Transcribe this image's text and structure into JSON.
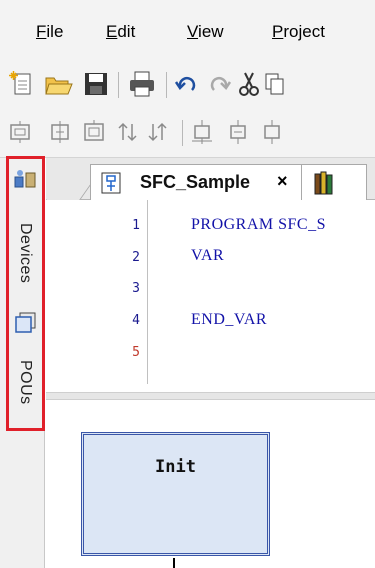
{
  "menu": {
    "items": [
      {
        "label": "File",
        "underline": "F"
      },
      {
        "label": "Edit",
        "underline": "E"
      },
      {
        "label": "View",
        "underline": "V"
      },
      {
        "label": "Project",
        "underline": "P"
      }
    ]
  },
  "toolbar": {
    "row1_icons": [
      "new-file-icon",
      "open-folder-icon",
      "save-icon",
      "print-icon",
      "undo-icon",
      "redo-icon",
      "cut-icon",
      "copy-icon"
    ],
    "row2_icons": [
      "frame-icon-1",
      "frame-icon-2",
      "frame-icon-3",
      "sort-up-icon",
      "sort-down-icon",
      "insert-step-icon",
      "insert-branch-icon",
      "insert-jump-icon"
    ]
  },
  "side_tabs": [
    {
      "label": "Devices",
      "icon": "devices-icon"
    },
    {
      "label": "POUs",
      "icon": "pous-icon"
    }
  ],
  "editor_tab": {
    "title": "SFC_Sample",
    "close_glyph": "×",
    "icon": "sfc-pou-icon",
    "next_tab_icon": "library-icon"
  },
  "code": {
    "lines": [
      {
        "number": "1",
        "text": "PROGRAM SFC_S"
      },
      {
        "number": "2",
        "text": "VAR"
      },
      {
        "number": "3",
        "text": ""
      },
      {
        "number": "4",
        "text": "END_VAR"
      },
      {
        "number": "5",
        "text": ""
      }
    ],
    "last_line_color": "#c0392b"
  },
  "sfc": {
    "init_step": "Init",
    "step_fill": "#dce6f5",
    "step_border": "#3a56a8"
  },
  "colors": {
    "highlight": "#e0202a",
    "code_text": "#1212a8"
  }
}
